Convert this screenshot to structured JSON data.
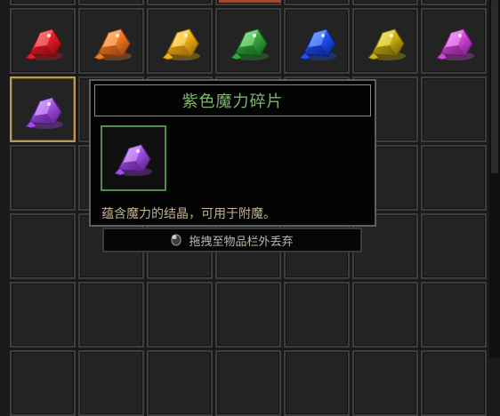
{
  "tooltip": {
    "title": "紫色魔力碎片",
    "description": "蕴含魔力的结晶，可用于附魔。",
    "title_color": "#7fb56b",
    "desc_color": "#c2b38e"
  },
  "drop_hint": {
    "icon": "mouse-icon",
    "label": "拖拽至物品栏外丢弃"
  },
  "inventory": {
    "gems": [
      {
        "name": "red-crystal-shard",
        "color": "#e01e2a",
        "light": "#ff8a8a",
        "dark": "#7a0810"
      },
      {
        "name": "orange-crystal-shard",
        "color": "#f07a22",
        "light": "#ffc38a",
        "dark": "#8a3a0a"
      },
      {
        "name": "gold-crystal-shard",
        "color": "#f2b218",
        "light": "#ffe58a",
        "dark": "#8a5a06"
      },
      {
        "name": "green-crystal-shard",
        "color": "#35a63a",
        "light": "#9fe79f",
        "dark": "#11551a"
      },
      {
        "name": "blue-crystal-shard",
        "color": "#1e4ff0",
        "light": "#8ab0ff",
        "dark": "#0a1f7a"
      },
      {
        "name": "yellow-crystal-shard",
        "color": "#c9b20e",
        "light": "#f5e97a",
        "dark": "#5f5205"
      },
      {
        "name": "magenta-crystal-shard",
        "color": "#d24ad8",
        "light": "#f3a8f5",
        "dark": "#6d1672"
      }
    ],
    "selected_gem": {
      "name": "purple-crystal-shard",
      "color": "#a24ee0",
      "light": "#d9b0ff",
      "dark": "#4d1a7a"
    }
  }
}
